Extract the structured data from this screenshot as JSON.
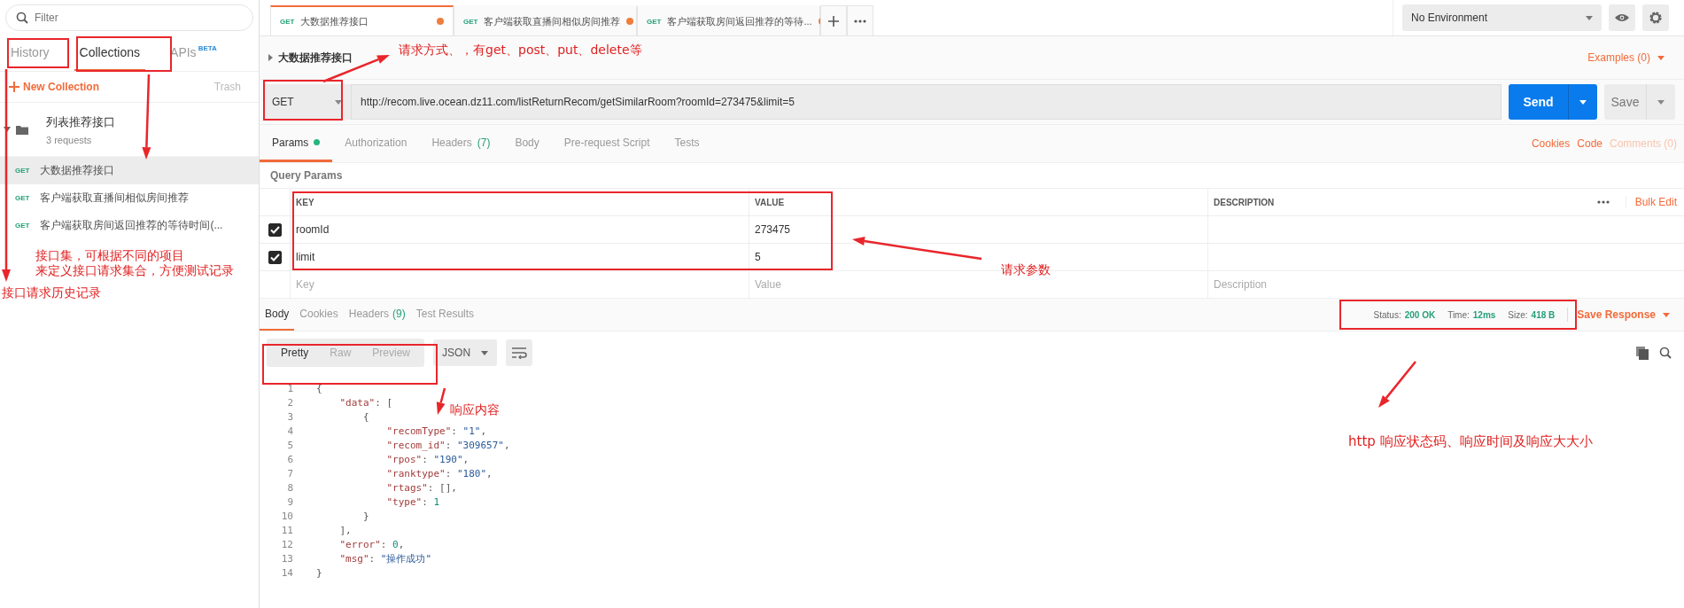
{
  "sidebar": {
    "filter_placeholder": "Filter",
    "tabs": [
      {
        "label": "History",
        "selected": false
      },
      {
        "label": "Collections",
        "selected": true
      },
      {
        "label": "APIs",
        "badge": "BETA",
        "selected": false
      }
    ],
    "new_collection": "New Collection",
    "trash": "Trash",
    "collection": {
      "name": "列表推荐接口",
      "count": "3 requests",
      "expanded": true,
      "requests": [
        {
          "method": "GET",
          "name": "大数据推荐接口",
          "selected": true
        },
        {
          "method": "GET",
          "name": "客户端获取直播间相似房间推荐",
          "selected": false
        },
        {
          "method": "GET",
          "name": "客户端获取房间返回推荐的等待时间(...",
          "selected": false
        }
      ]
    }
  },
  "request_tabs": [
    {
      "method": "GET",
      "name": "大数据推荐接口",
      "selected": true,
      "unsaved": true
    },
    {
      "method": "GET",
      "name": "客户端获取直播间相似房间推荐",
      "selected": false,
      "unsaved": true
    },
    {
      "method": "GET",
      "name": "客户端获取房间返回推荐的等待...",
      "selected": false,
      "unsaved": true
    }
  ],
  "environment": "No Environment",
  "request": {
    "name": "大数据推荐接口",
    "examples": "Examples (0)",
    "method": "GET",
    "url": "http://recom.live.ocean.dz11.com/listReturnRecom/getSimilarRoom?roomId=273475&limit=5",
    "send": "Send",
    "save": "Save"
  },
  "request_subtabs": [
    {
      "label": "Params",
      "selected": true,
      "dot": true
    },
    {
      "label": "Authorization",
      "selected": false
    },
    {
      "label": "Headers",
      "count": "(7)",
      "selected": false
    },
    {
      "label": "Body",
      "selected": false
    },
    {
      "label": "Pre-request Script",
      "selected": false
    },
    {
      "label": "Tests",
      "selected": false
    }
  ],
  "request_links": [
    {
      "label": "Cookies",
      "disabled": false
    },
    {
      "label": "Code",
      "disabled": false
    },
    {
      "label": "Comments (0)",
      "disabled": true
    }
  ],
  "query_params": {
    "title": "Query Params",
    "columns": [
      "KEY",
      "VALUE",
      "DESCRIPTION"
    ],
    "bulk_edit": "Bulk Edit",
    "rows": [
      {
        "checked": true,
        "key": "roomId",
        "value": "273475"
      },
      {
        "checked": true,
        "key": "limit",
        "value": "5"
      }
    ],
    "placeholders": {
      "key": "Key",
      "value": "Value",
      "description": "Description"
    }
  },
  "response_tabs": [
    {
      "label": "Body",
      "selected": true
    },
    {
      "label": "Cookies",
      "selected": false
    },
    {
      "label": "Headers",
      "count": "(9)",
      "selected": false
    },
    {
      "label": "Test Results",
      "selected": false
    }
  ],
  "status": [
    {
      "label": "Status:",
      "value": "200 OK"
    },
    {
      "label": "Time:",
      "value": "12ms"
    },
    {
      "label": "Size:",
      "value": "418 B"
    }
  ],
  "save_response": "Save Response",
  "view_modes": [
    {
      "label": "Pretty",
      "selected": true
    },
    {
      "label": "Raw",
      "selected": false
    },
    {
      "label": "Preview",
      "selected": false
    }
  ],
  "format": "JSON",
  "code_lines": [
    {
      "number": "1",
      "tokens": [
        {
          "kind": "punct",
          "text": "{"
        }
      ]
    },
    {
      "number": "2",
      "tokens": [
        {
          "kind": "key",
          "text": "    \"data\""
        },
        {
          "kind": "punct",
          "text": ": ["
        }
      ]
    },
    {
      "number": "3",
      "tokens": [
        {
          "kind": "punct",
          "text": "        {"
        }
      ]
    },
    {
      "number": "4",
      "tokens": [
        {
          "kind": "key",
          "text": "            \"recomType\""
        },
        {
          "kind": "punct",
          "text": ": "
        },
        {
          "kind": "string",
          "text": "\"1\""
        },
        {
          "kind": "punct",
          "text": ","
        }
      ]
    },
    {
      "number": "5",
      "tokens": [
        {
          "kind": "key",
          "text": "            \"recom_id\""
        },
        {
          "kind": "punct",
          "text": ": "
        },
        {
          "kind": "string",
          "text": "\"309657\""
        },
        {
          "kind": "punct",
          "text": ","
        }
      ]
    },
    {
      "number": "6",
      "tokens": [
        {
          "kind": "key",
          "text": "            \"rpos\""
        },
        {
          "kind": "punct",
          "text": ": "
        },
        {
          "kind": "string",
          "text": "\"190\""
        },
        {
          "kind": "punct",
          "text": ","
        }
      ]
    },
    {
      "number": "7",
      "tokens": [
        {
          "kind": "key",
          "text": "            \"ranktype\""
        },
        {
          "kind": "punct",
          "text": ": "
        },
        {
          "kind": "string",
          "text": "\"180\""
        },
        {
          "kind": "punct",
          "text": ","
        }
      ]
    },
    {
      "number": "8",
      "tokens": [
        {
          "kind": "key",
          "text": "            \"rtags\""
        },
        {
          "kind": "punct",
          "text": ": [],"
        }
      ]
    },
    {
      "number": "9",
      "tokens": [
        {
          "kind": "key",
          "text": "            \"type\""
        },
        {
          "kind": "punct",
          "text": ": "
        },
        {
          "kind": "number",
          "text": "1"
        }
      ]
    },
    {
      "number": "10",
      "tokens": [
        {
          "kind": "punct",
          "text": "        }"
        }
      ]
    },
    {
      "number": "11",
      "tokens": [
        {
          "kind": "punct",
          "text": "    ],"
        }
      ]
    },
    {
      "number": "12",
      "tokens": [
        {
          "kind": "key",
          "text": "    \"error\""
        },
        {
          "kind": "punct",
          "text": ": "
        },
        {
          "kind": "number",
          "text": "0"
        },
        {
          "kind": "punct",
          "text": ","
        }
      ]
    },
    {
      "number": "13",
      "tokens": [
        {
          "kind": "key",
          "text": "    \"msg\""
        },
        {
          "kind": "punct",
          "text": ": "
        },
        {
          "kind": "string",
          "text": "\"操作成功\""
        }
      ]
    },
    {
      "number": "14",
      "tokens": [
        {
          "kind": "punct",
          "text": "}"
        }
      ]
    }
  ],
  "annotations": [
    {
      "lines": [
        "请求方式、，有get、post、put、delete等"
      ]
    },
    {
      "lines": [
        "接口集，可根据不同的项目",
        "来定义接口请求集合，方便测试记录"
      ]
    },
    {
      "lines": [
        "接口请求历史记录"
      ]
    },
    {
      "lines": [
        "请求参数"
      ]
    },
    {
      "lines": [
        "响应内容"
      ]
    },
    {
      "lines": [
        "http 响应状态码、响应时间及响应大大小"
      ]
    }
  ]
}
